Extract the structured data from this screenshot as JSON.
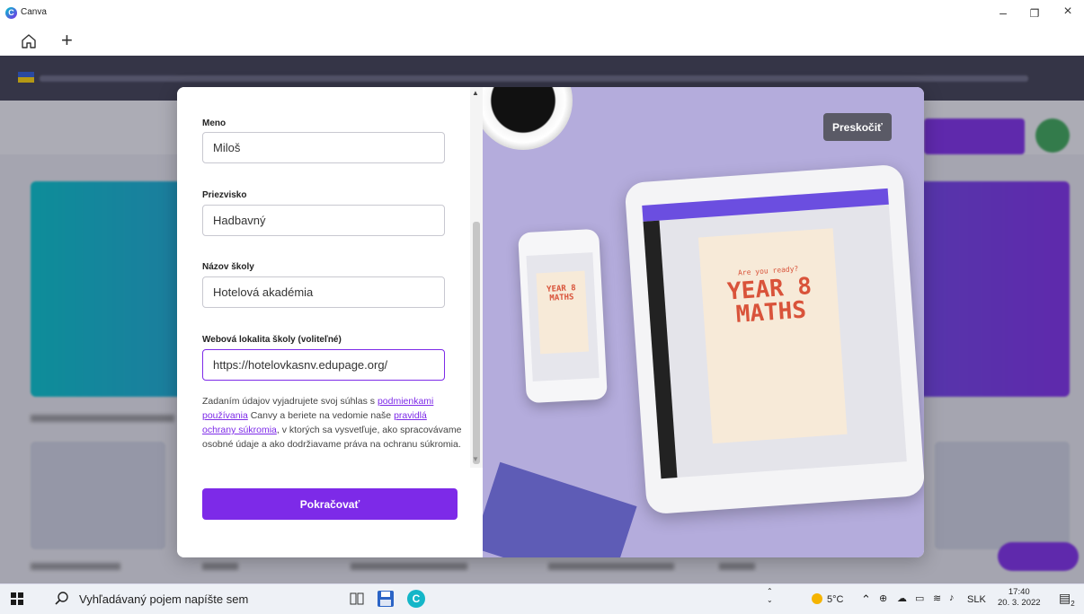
{
  "window": {
    "title": "Canva",
    "min": "–",
    "max": "❐",
    "close": "×"
  },
  "tabs": {
    "home_icon": "home-icon",
    "new_tab": "+"
  },
  "form": {
    "first_name_label": "Meno",
    "first_name_value": "Miloš",
    "last_name_label": "Priezvisko",
    "last_name_value": "Hadbavný",
    "school_label": "Názov školy",
    "school_value": "Hotelová akadémia",
    "website_label": "Webová lokalita školy (voliteľné)",
    "website_value": "https://hotelovkasnv.edupage.org/",
    "consent_1": "Zadaním údajov vyjadrujete svoj súhlas s ",
    "terms_link": "podmienkami používania",
    "consent_2": " Canvy a beriete na vedomie naše ",
    "privacy_link": "pravidlá ochrany súkromia",
    "consent_3": ", v ktorých sa vysvetľuje, ako spracovávame osobné údaje a ako dodržiavame práva na ochranu súkromia.",
    "continue_button": "Pokračovať"
  },
  "illustration": {
    "skip_button": "Preskočiť",
    "poster_small": "Are you ready?",
    "poster_title": "YEAR 8 MATHS",
    "phone_title": "YEAR 8 MATHS"
  },
  "taskbar": {
    "search_placeholder": "Vyhľadávaný pojem napíšte sem",
    "weather": "5°C",
    "language": "SLK",
    "time": "17:40",
    "date": "20. 3. 2022",
    "notifications": "2"
  },
  "colors": {
    "accent": "#7d2ae8",
    "skip_bg": "#5a5a66",
    "illustration_bg": "#b4acdc"
  }
}
